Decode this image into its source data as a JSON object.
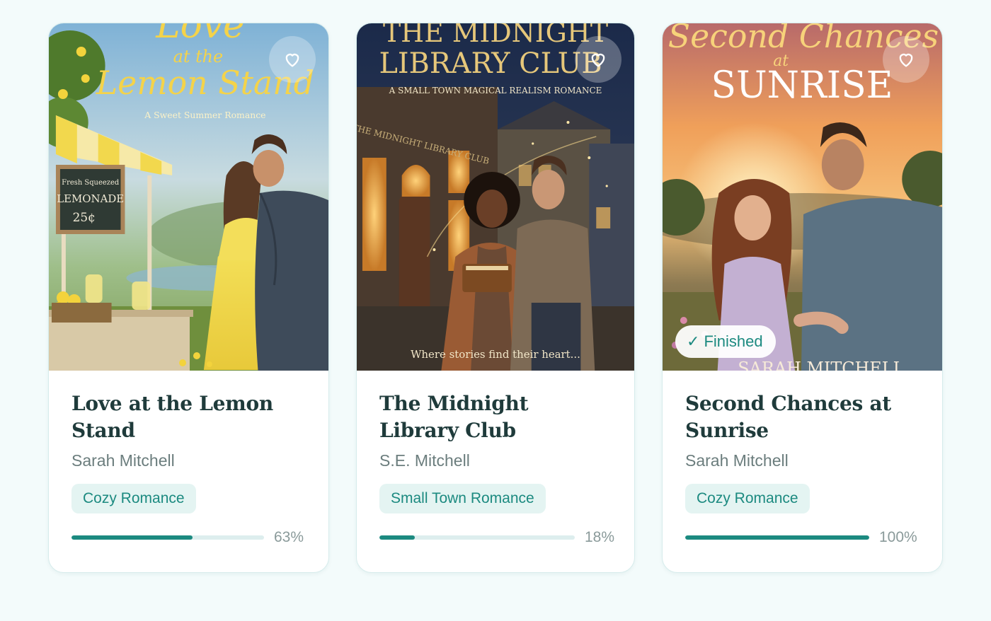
{
  "colors": {
    "accent": "#1c8a80",
    "page_bg": "#f3fbfb",
    "tag_bg": "#e4f4f2",
    "track_bg": "#ddeeee"
  },
  "books": [
    {
      "title": "Love at the Lemon Stand",
      "author": "Sarah Mitchell",
      "genre": "Cozy Romance",
      "progress": 63,
      "progress_label": "63%",
      "favorite_icon": "heart-outline-icon",
      "cover": {
        "title_line1": "Love",
        "title_line2": "at the",
        "title_line3": "Lemon Stand",
        "tagline": "A Sweet Summer Romance",
        "sign_line1": "Fresh Squeezed",
        "sign_line2": "LEMONADE",
        "sign_line3": "25¢"
      }
    },
    {
      "title": "The Midnight Library Club",
      "author": "S.E. Mitchell",
      "genre": "Small Town Romance",
      "progress": 18,
      "progress_label": "18%",
      "favorite_icon": "heart-outline-icon",
      "cover": {
        "title_line1": "THE MIDNIGHT",
        "title_line2": "LIBRARY CLUB",
        "subtitle": "A SMALL TOWN MAGICAL REALISM ROMANCE",
        "shop_sign": "THE MIDNIGHT LIBRARY CLUB",
        "tagline": "Where stories find their heart..."
      }
    },
    {
      "title": "Second Chances at Sunrise",
      "author": "Sarah Mitchell",
      "genre": "Cozy Romance",
      "progress": 100,
      "progress_label": "100%",
      "favorite_icon": "heart-outline-icon",
      "finished_label": "Finished",
      "cover": {
        "title_line1": "Second Chances",
        "title_line2": "at",
        "title_line3": "SUNRISE",
        "author_line": "SARAH MITCHELL"
      }
    }
  ]
}
